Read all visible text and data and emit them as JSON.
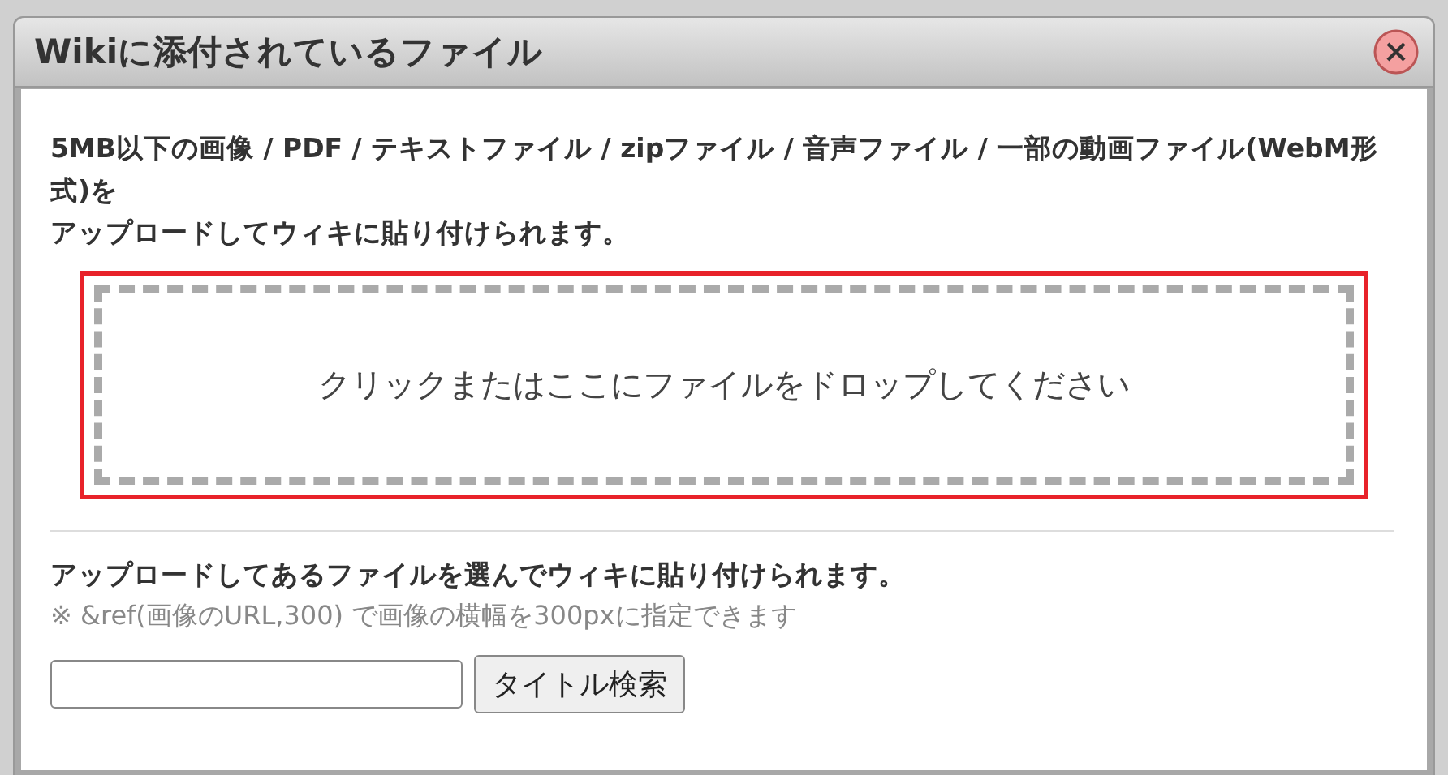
{
  "dialog": {
    "title": "Wikiに添付されているファイル",
    "intro": [
      "5MB以下の画像 / PDF / テキストファイル / zipファイル / 音声ファイル / 一部の動画ファイル(WebM形式)を",
      "アップロードしてウィキに貼り付けられます。"
    ],
    "drop_zone": {
      "label": "クリックまたはここにファイルをドロップしてください",
      "selected": true
    },
    "existing_heading": "アップロードしてあるファイルを選んでウィキに貼り付けられます。",
    "hint": "※ &ref(画像のURL,300) で画像の横幅を300pxに指定できます",
    "search": {
      "button": "タイトル検索"
    }
  }
}
